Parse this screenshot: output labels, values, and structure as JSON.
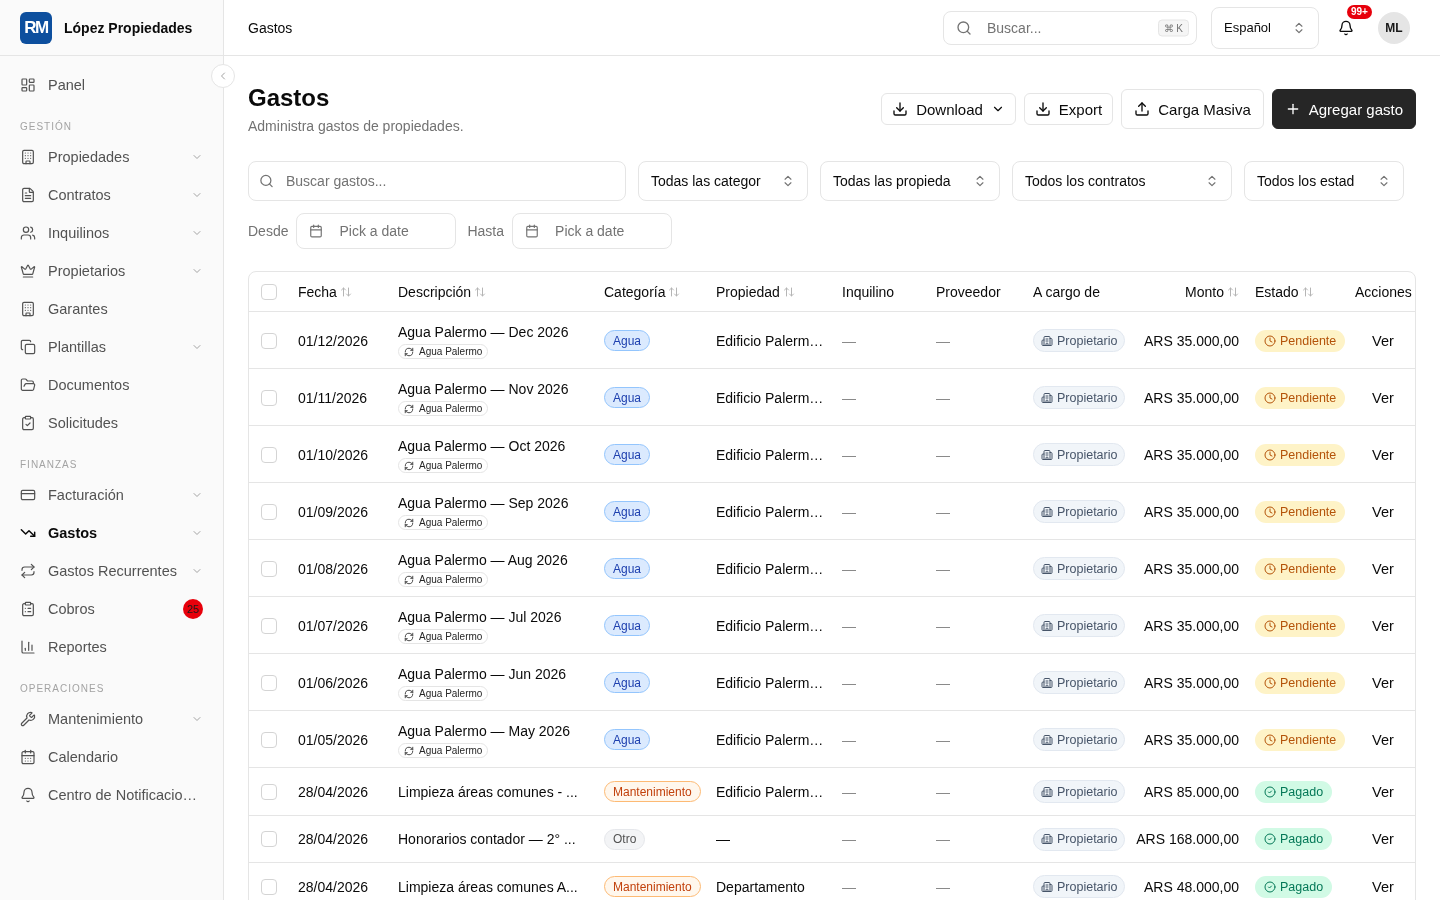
{
  "sidebar": {
    "brand": {
      "logo_text": "RM",
      "name": "López Propiedades"
    },
    "sections": [
      {
        "items": [
          {
            "label": "Panel",
            "expandable": false,
            "selected": false
          }
        ]
      },
      {
        "title": "GESTIÓN",
        "items": [
          {
            "label": "Propiedades",
            "expandable": true,
            "selected": false
          },
          {
            "label": "Contratos",
            "expandable": true,
            "selected": false
          },
          {
            "label": "Inquilinos",
            "expandable": true,
            "selected": false
          },
          {
            "label": "Propietarios",
            "expandable": true,
            "selected": false
          },
          {
            "label": "Garantes",
            "expandable": false,
            "selected": false
          },
          {
            "label": "Plantillas",
            "expandable": true,
            "selected": false
          },
          {
            "label": "Documentos",
            "expandable": false,
            "selected": false
          },
          {
            "label": "Solicitudes",
            "expandable": false,
            "selected": false
          }
        ]
      },
      {
        "title": "FINANZAS",
        "items": [
          {
            "label": "Facturación",
            "expandable": true,
            "selected": false
          },
          {
            "label": "Gastos",
            "expandable": true,
            "selected": true
          },
          {
            "label": "Gastos Recurrentes",
            "expandable": true,
            "selected": false
          },
          {
            "label": "Cobros",
            "expandable": false,
            "selected": false,
            "badge": "25"
          },
          {
            "label": "Reportes",
            "expandable": false,
            "selected": false
          }
        ]
      },
      {
        "title": "OPERACIONES",
        "items": [
          {
            "label": "Mantenimiento",
            "expandable": true,
            "selected": false
          },
          {
            "label": "Calendario",
            "expandable": false,
            "selected": false
          },
          {
            "label": "Centro de Notificacio…",
            "expandable": false,
            "selected": false
          }
        ]
      }
    ]
  },
  "topbar": {
    "breadcrumb": "Gastos",
    "search": {
      "placeholder": "Buscar...",
      "shortcut": "⌘ K"
    },
    "language": {
      "value": "Español"
    },
    "notifications": {
      "badge": "99+"
    },
    "user": {
      "initials": "ML"
    }
  },
  "page": {
    "title": "Gastos",
    "subtitle": "Administra gastos de propiedades.",
    "actions": [
      {
        "label": "Download",
        "kind": "dropdown"
      },
      {
        "label": "Export",
        "kind": "export"
      },
      {
        "label": "Carga Masiva",
        "kind": "upload"
      },
      {
        "label": "Agregar gasto",
        "kind": "primary"
      }
    ],
    "filters": {
      "search": {
        "placeholder": "Buscar gastos..."
      },
      "selects": [
        {
          "value": "Todas las categor"
        },
        {
          "value": "Todas las propieda"
        },
        {
          "value": "Todos los contratos"
        },
        {
          "value": "Todos los estad"
        }
      ]
    },
    "date_range": [
      {
        "label": "Desde",
        "placeholder": "Pick a date"
      },
      {
        "label": "Hasta",
        "placeholder": "Pick a date"
      }
    ],
    "table": {
      "select_all": {
        "checked": false
      },
      "columns": [
        {
          "label": "Fecha",
          "sortable": true
        },
        {
          "label": "Descripción",
          "sortable": true
        },
        {
          "label": "Categoría",
          "sortable": true
        },
        {
          "label": "Propiedad",
          "sortable": true
        },
        {
          "label": "Inquilino",
          "sortable": false
        },
        {
          "label": "Proveedor",
          "sortable": false
        },
        {
          "label": "A cargo de",
          "sortable": false
        },
        {
          "label": "Monto",
          "sortable": true
        },
        {
          "label": "Estado",
          "sortable": true
        },
        {
          "label": "Acciones",
          "sortable": false
        }
      ],
      "rows": [
        {
          "checked": false,
          "date": "01/12/2026",
          "description": "Agua Palermo — Dec 2026",
          "recurring": "Agua Palermo",
          "category": {
            "label": "Agua",
            "kind": "water"
          },
          "property": "Edificio Palerm…",
          "tenant": "—",
          "supplier": "—",
          "payer": "Propietario",
          "amount": "ARS 35.000,00",
          "status": {
            "label": "Pendiente",
            "kind": "pending"
          },
          "action": "Ver"
        },
        {
          "checked": false,
          "date": "01/11/2026",
          "description": "Agua Palermo — Nov 2026",
          "recurring": "Agua Palermo",
          "category": {
            "label": "Agua",
            "kind": "water"
          },
          "property": "Edificio Palerm…",
          "tenant": "—",
          "supplier": "—",
          "payer": "Propietario",
          "amount": "ARS 35.000,00",
          "status": {
            "label": "Pendiente",
            "kind": "pending"
          },
          "action": "Ver"
        },
        {
          "checked": false,
          "date": "01/10/2026",
          "description": "Agua Palermo — Oct 2026",
          "recurring": "Agua Palermo",
          "category": {
            "label": "Agua",
            "kind": "water"
          },
          "property": "Edificio Palerm…",
          "tenant": "—",
          "supplier": "—",
          "payer": "Propietario",
          "amount": "ARS 35.000,00",
          "status": {
            "label": "Pendiente",
            "kind": "pending"
          },
          "action": "Ver"
        },
        {
          "checked": false,
          "date": "01/09/2026",
          "description": "Agua Palermo — Sep 2026",
          "recurring": "Agua Palermo",
          "category": {
            "label": "Agua",
            "kind": "water"
          },
          "property": "Edificio Palerm…",
          "tenant": "—",
          "supplier": "—",
          "payer": "Propietario",
          "amount": "ARS 35.000,00",
          "status": {
            "label": "Pendiente",
            "kind": "pending"
          },
          "action": "Ver"
        },
        {
          "checked": false,
          "date": "01/08/2026",
          "description": "Agua Palermo — Aug 2026",
          "recurring": "Agua Palermo",
          "category": {
            "label": "Agua",
            "kind": "water"
          },
          "property": "Edificio Palerm…",
          "tenant": "—",
          "supplier": "—",
          "payer": "Propietario",
          "amount": "ARS 35.000,00",
          "status": {
            "label": "Pendiente",
            "kind": "pending"
          },
          "action": "Ver"
        },
        {
          "checked": false,
          "date": "01/07/2026",
          "description": "Agua Palermo — Jul 2026",
          "recurring": "Agua Palermo",
          "category": {
            "label": "Agua",
            "kind": "water"
          },
          "property": "Edificio Palerm…",
          "tenant": "—",
          "supplier": "—",
          "payer": "Propietario",
          "amount": "ARS 35.000,00",
          "status": {
            "label": "Pendiente",
            "kind": "pending"
          },
          "action": "Ver"
        },
        {
          "checked": false,
          "date": "01/06/2026",
          "description": "Agua Palermo — Jun 2026",
          "recurring": "Agua Palermo",
          "category": {
            "label": "Agua",
            "kind": "water"
          },
          "property": "Edificio Palerm…",
          "tenant": "—",
          "supplier": "—",
          "payer": "Propietario",
          "amount": "ARS 35.000,00",
          "status": {
            "label": "Pendiente",
            "kind": "pending"
          },
          "action": "Ver"
        },
        {
          "checked": false,
          "date": "01/05/2026",
          "description": "Agua Palermo — May 2026",
          "recurring": "Agua Palermo",
          "category": {
            "label": "Agua",
            "kind": "water"
          },
          "property": "Edificio Palerm…",
          "tenant": "—",
          "supplier": "—",
          "payer": "Propietario",
          "amount": "ARS 35.000,00",
          "status": {
            "label": "Pendiente",
            "kind": "pending"
          },
          "action": "Ver"
        },
        {
          "checked": false,
          "date": "28/04/2026",
          "description": "Limpieza áreas comunes - ...",
          "category": {
            "label": "Mantenimiento",
            "kind": "maintenance"
          },
          "property": "Edificio Palerm…",
          "tenant": "—",
          "supplier": "—",
          "payer": "Propietario",
          "amount": "ARS 85.000,00",
          "status": {
            "label": "Pagado",
            "kind": "paid"
          },
          "action": "Ver"
        },
        {
          "checked": false,
          "date": "28/04/2026",
          "description": "Honorarios contador — 2° ...",
          "category": {
            "label": "Otro",
            "kind": "other"
          },
          "property": "—",
          "tenant": "—",
          "supplier": "—",
          "payer": "Propietario",
          "amount": "ARS 168.000,00",
          "status": {
            "label": "Pagado",
            "kind": "paid"
          },
          "action": "Ver"
        },
        {
          "checked": false,
          "date": "28/04/2026",
          "description": "Limpieza áreas comunes A...",
          "category": {
            "label": "Mantenimiento",
            "kind": "maintenance"
          },
          "property": "Departamento",
          "tenant": "—",
          "supplier": "—",
          "payer": "Propietario",
          "amount": "ARS 48.000,00",
          "status": {
            "label": "Pagado",
            "kind": "paid"
          },
          "action": "Ver"
        }
      ]
    }
  }
}
